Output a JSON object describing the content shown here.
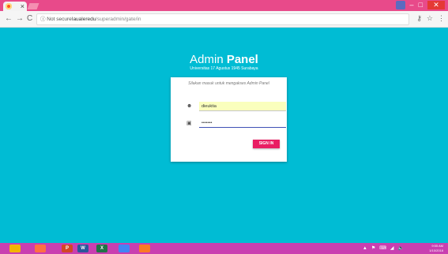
{
  "browser": {
    "tab_close": "×",
    "nav": {
      "back": "←",
      "forward": "→",
      "reload": "C"
    },
    "address": {
      "security": "ⓘ Not secure",
      "host": "laualeredu",
      "path": "/superadmin/gate/in"
    },
    "toolbar_icons": {
      "key": "⚷",
      "star": "☆",
      "menu": "⋮"
    },
    "window": {
      "minimize": "–",
      "maximize": "□",
      "close": "✕"
    }
  },
  "brand": {
    "title_light": "Admin ",
    "title_bold": "Panel",
    "subtitle": "Universitas 17 Agustus 1945 Surabaya"
  },
  "login": {
    "message": "Silakan masuk untuk mengakses Admin Panel",
    "username_value": "dieuktia",
    "password_value": "•••••••",
    "signin_label": "SIGN IN"
  },
  "taskbar": {
    "apps": [
      {
        "name": "explorer",
        "label": "",
        "color": "#f4b400"
      },
      {
        "name": "browser-orb",
        "label": "",
        "color": "#ff7043"
      },
      {
        "name": "powerpoint",
        "label": "P",
        "color": "#d24726"
      },
      {
        "name": "word",
        "label": "W",
        "color": "#2b579a"
      },
      {
        "name": "excel",
        "label": "X",
        "color": "#217346"
      },
      {
        "name": "chrome",
        "label": "",
        "color": "#4285f4"
      },
      {
        "name": "xampp",
        "label": "",
        "color": "#fb7a24"
      }
    ],
    "tray": [
      "▲",
      "⚑",
      "⌨",
      "◢",
      "🔈"
    ],
    "time": "9:55 AM",
    "date": "1/10/2018"
  },
  "colors": {
    "background": "#00bcd4",
    "accent": "#e91e63",
    "titlebar": "#e84a8a",
    "taskbar": "#c93fb0"
  }
}
